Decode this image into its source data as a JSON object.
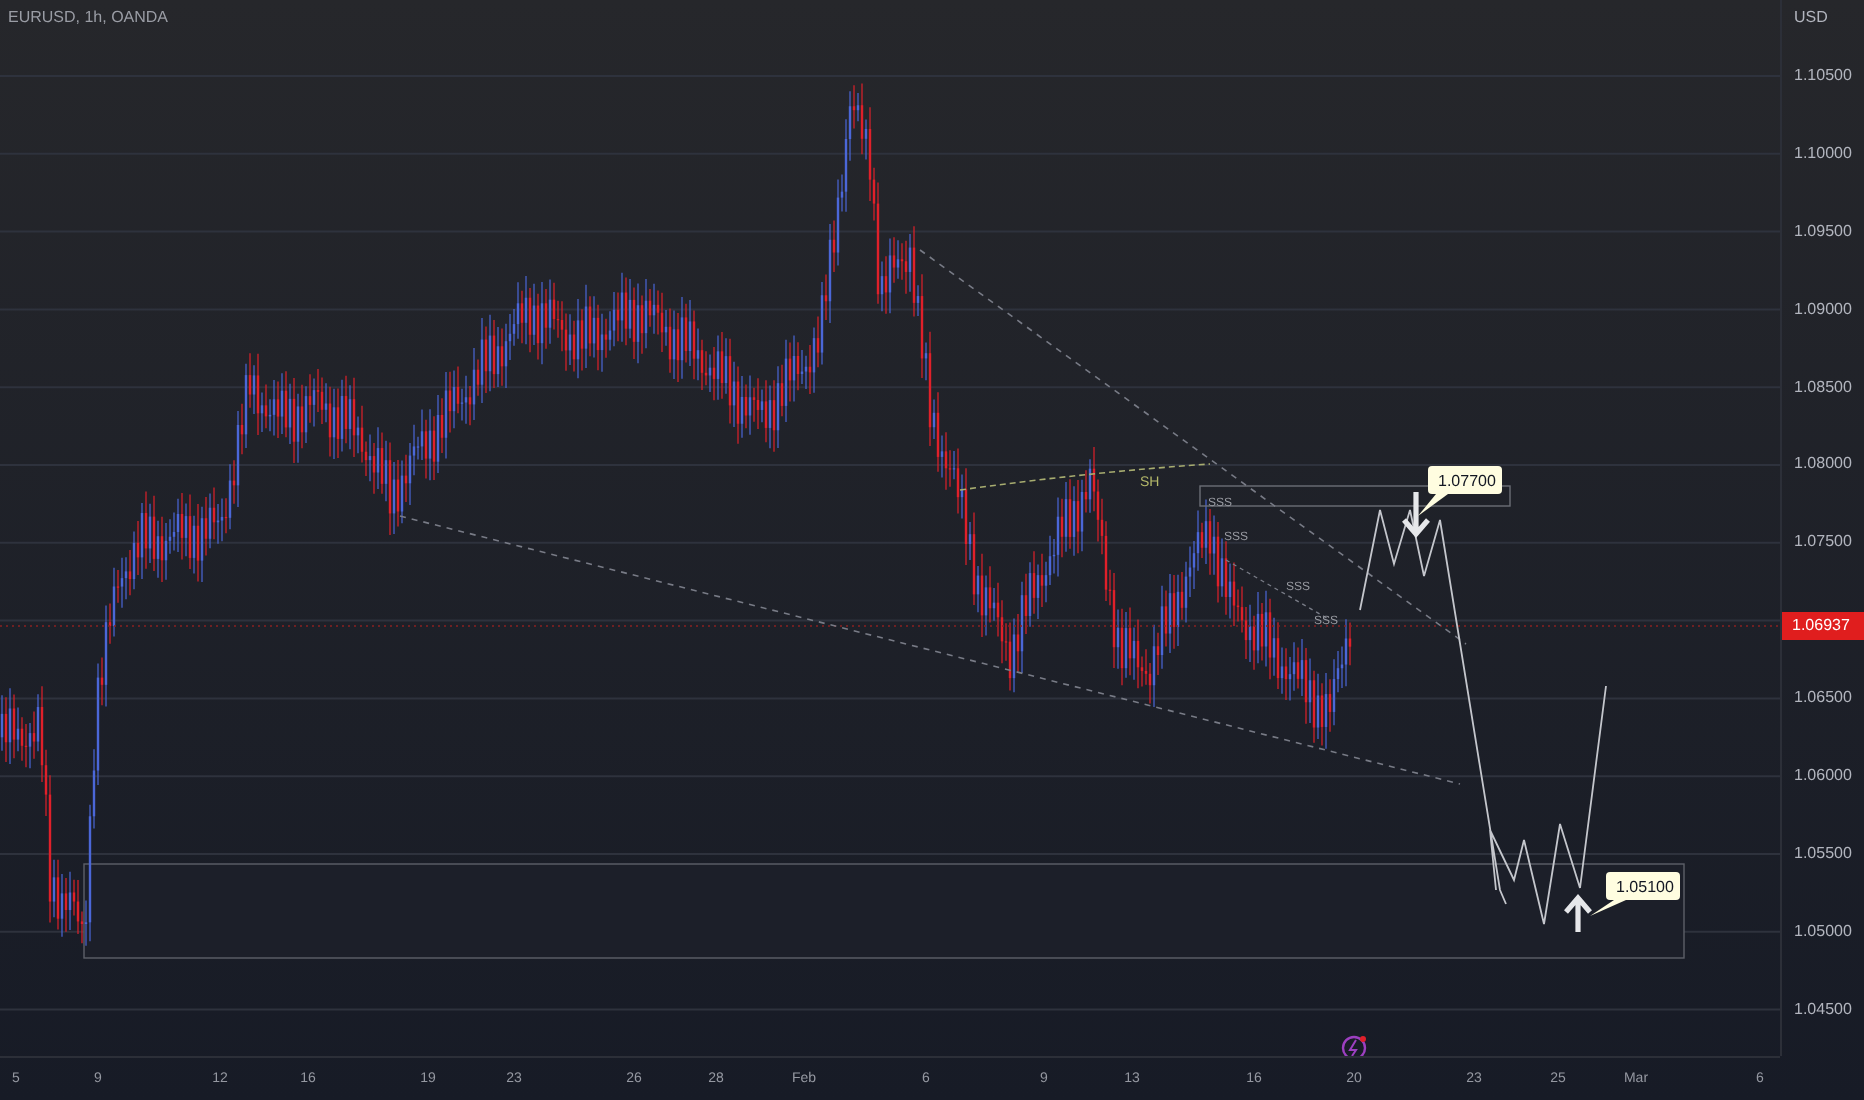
{
  "header": {
    "title": "EURUSD, 1h, OANDA"
  },
  "price_axis": {
    "currency": "USD",
    "labels": [
      "1.10500",
      "1.10000",
      "1.09500",
      "1.09000",
      "1.08500",
      "1.08000",
      "1.07500",
      "1.06500",
      "1.06000",
      "1.05500",
      "1.05000",
      "1.04500"
    ],
    "current_price": "1.06937"
  },
  "time_axis": {
    "labels": [
      "5",
      "9",
      "12",
      "16",
      "19",
      "23",
      "26",
      "28",
      "Feb",
      "6",
      "9",
      "13",
      "16",
      "20",
      "23",
      "25",
      "Mar",
      "6"
    ]
  },
  "annotations": {
    "level_label": "SH",
    "sweep_labels": [
      "SSS",
      "SSS",
      "SSS",
      "SSS"
    ],
    "callouts": [
      "1.07700",
      "1.05100"
    ]
  }
}
